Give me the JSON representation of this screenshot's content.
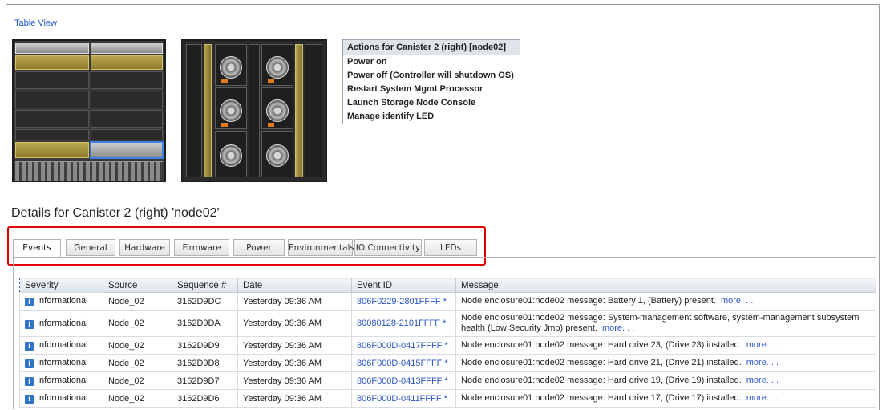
{
  "table_view_label": "Table View",
  "actions": {
    "title": "Actions for Canister 2 (right) [node02]",
    "items": [
      "Power on",
      "Power off (Controller will shutdown OS)",
      "Restart System Mgmt Processor",
      "Launch Storage Node Console",
      "Manage identify LED"
    ]
  },
  "details_title": "Details for Canister 2 (right) 'node02'",
  "tabs": [
    "Events",
    "General",
    "Hardware",
    "Firmware",
    "Power",
    "Environmentals",
    "IO Connectivity",
    "LEDs"
  ],
  "active_tab": "Events",
  "columns": [
    "Severity",
    "Source",
    "Sequence #",
    "Date",
    "Event ID",
    "Message"
  ],
  "rows": [
    {
      "severity": "Informational",
      "source": "Node_02",
      "sequence": "3162D9DC",
      "date": "Yesterday 09:36 AM",
      "event_id": "806F0229-2801FFFF *",
      "message": "Node enclosure01:node02 message: Battery 1, (Battery) present.",
      "more": "more. . ."
    },
    {
      "severity": "Informational",
      "source": "Node_02",
      "sequence": "3162D9DA",
      "date": "Yesterday 09:36 AM",
      "event_id": "80080128-2101FFFF *",
      "message": "Node enclosure01:node02 message: System-management software, system-management subsystem health (Low Security Jmp) present.",
      "more": "more. . ."
    },
    {
      "severity": "Informational",
      "source": "Node_02",
      "sequence": "3162D9D9",
      "date": "Yesterday 09:36 AM",
      "event_id": "806F000D-0417FFFF *",
      "message": "Node enclosure01:node02 message: Hard drive 23, (Drive 23) installed.",
      "more": "more. . ."
    },
    {
      "severity": "Informational",
      "source": "Node_02",
      "sequence": "3162D9D8",
      "date": "Yesterday 09:36 AM",
      "event_id": "806F000D-0415FFFF *",
      "message": "Node enclosure01:node02 message: Hard drive 21, (Drive 21) installed.",
      "more": "more. . ."
    },
    {
      "severity": "Informational",
      "source": "Node_02",
      "sequence": "3162D9D7",
      "date": "Yesterday 09:36 AM",
      "event_id": "806F000D-0413FFFF *",
      "message": "Node enclosure01:node02 message: Hard drive 19, (Drive 19) installed.",
      "more": "more. . ."
    },
    {
      "severity": "Informational",
      "source": "Node_02",
      "sequence": "3162D9D6",
      "date": "Yesterday 09:36 AM",
      "event_id": "806F000D-0411FFFF *",
      "message": "Node enclosure01:node02 message: Hard drive 17, (Drive 17) installed.",
      "more": "more. . ."
    }
  ],
  "colors": {
    "link": "#2c55c7",
    "highlight": "#e00000",
    "selected": "#3d7fe6"
  },
  "icons": {
    "severity": "info-icon"
  }
}
